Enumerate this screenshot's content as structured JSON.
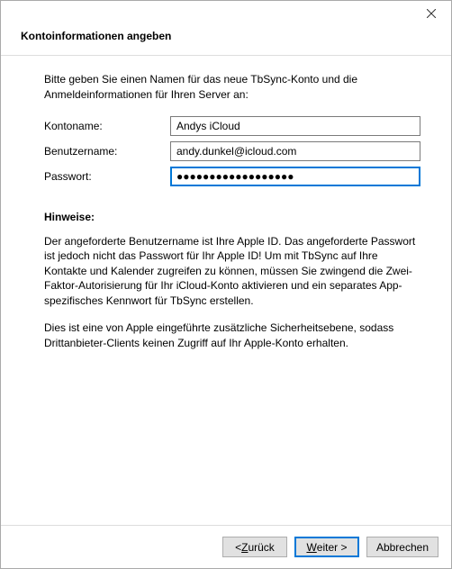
{
  "window": {
    "title": "Kontoinformationen angeben"
  },
  "intro": "Bitte geben Sie einen Namen für das neue TbSync-Konto und die Anmeldeinformationen für Ihren Server an:",
  "form": {
    "account_label": "Kontoname:",
    "account_value": "Andys iCloud",
    "user_label": "Benutzername:",
    "user_value": "andy.dunkel@icloud.com",
    "password_label": "Passwort:",
    "password_value": "●●●●●●●●●●●●●●●●●●"
  },
  "hints": {
    "title": "Hinweise:",
    "p1": "Der angeforderte Benutzername ist Ihre Apple ID. Das angeforderte Passwort ist jedoch nicht das Passwort für Ihr Apple ID! Um mit TbSync auf Ihre Kontakte und Kalender zugreifen zu können, müssen Sie zwingend die Zwei-Faktor-Autorisierung für Ihr iCloud-Konto aktivieren und ein separates App-spezifisches Kennwort für TbSync erstellen.",
    "p2": "Dies ist eine von Apple eingeführte zusätzliche Sicherheitsebene, sodass Drittanbieter-Clients keinen Zugriff auf Ihr Apple-Konto erhalten."
  },
  "buttons": {
    "back_prefix": "< ",
    "back_char": "Z",
    "back_rest": "urück",
    "next_char": "W",
    "next_rest": "eiter >",
    "cancel": "Abbrechen"
  }
}
